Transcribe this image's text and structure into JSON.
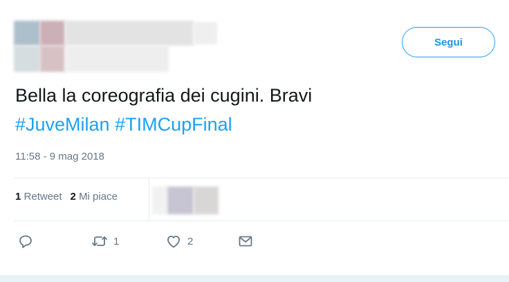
{
  "follow_button": {
    "label": "Segui"
  },
  "tweet": {
    "text_plain": "Bella la coreografia dei cugini. Bravi",
    "hashtags": [
      "#JuveMilan",
      "#TIMCupFinal"
    ],
    "timestamp": "11:58 - 9 mag 2018"
  },
  "stats": {
    "retweets_count": "1",
    "retweets_label": "Retweet",
    "likes_count": "2",
    "likes_label": "Mi piace"
  },
  "actions": {
    "reply_icon": "reply-icon",
    "retweet_icon": "retweet-icon",
    "retweet_count": "1",
    "like_icon": "heart-icon",
    "like_count": "2",
    "dm_icon": "envelope-icon"
  },
  "colors": {
    "accent": "#1da1f2",
    "muted": "#657786",
    "divider": "#e6ecf0"
  }
}
